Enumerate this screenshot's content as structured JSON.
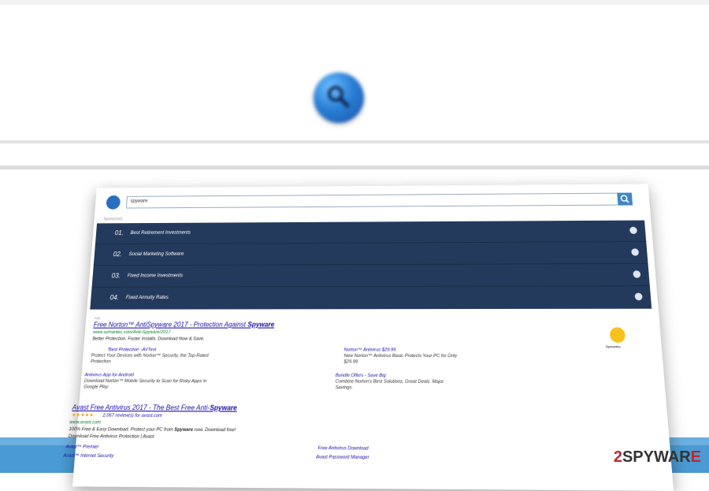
{
  "panel": {
    "search_value": "spyware",
    "sponsored_label": "Sponsored",
    "nav": [
      {
        "num": "01.",
        "label": "Best Retirement Investments"
      },
      {
        "num": "02.",
        "label": "Social Marketing Software"
      },
      {
        "num": "03.",
        "label": "Fixed Income Investments"
      },
      {
        "num": "04.",
        "label": "Fixed Annuity Rates"
      }
    ],
    "ads_label": "Ads",
    "ad1": {
      "title_prefix": "Free Norton™ AntiSpyware 2017 - Protection Against ",
      "title_bold": "Spyware",
      "url": "www.symantec.com/Anti-Spyware/2017",
      "desc": "Better Protection. Faster Installs. Download Now & Save.",
      "logo_text": "Symantec.",
      "sublinks": [
        {
          "title": "'Best Protection' -AVTest",
          "desc": "Protect Your Devices with Norton™ Security, the Top-Rated Protection"
        },
        {
          "title": "Norton™ Antivirus $29.99",
          "desc": "New Norton™ Antivirus Basic Protects Your PC for Only $29.99"
        },
        {
          "title": "Antivirus App for Android",
          "desc": "Download Norton™ Mobile Security to Scan for Risky Apps in Google Play"
        },
        {
          "title": "Bundle Offers - Save Big",
          "desc": "Combine Norton's Best Solutions. Great Deals. Major Savings."
        }
      ]
    },
    "ad2": {
      "title_prefix": "Avast Free Antivirus 2017 - The Best Free Anti-",
      "title_bold": "Spyware",
      "stars": "★★★★★",
      "reviews": "2,067 review(s) for avast.com",
      "url": "www.avast.com",
      "desc1_a": "100% Free & Easy Download. Protect your PC from ",
      "desc1_b": "Spyware",
      "desc1_c": " now. Download free!",
      "desc2": "Download Free Antivirus Protection | Avast",
      "sublinks": [
        "Avast™ Premier",
        "Free Antivirus Download",
        "Avast™ Internet Security",
        "Avast Password Manager"
      ]
    }
  },
  "watermark": {
    "two": "2",
    "mid": "SPYWAR",
    "e": "E"
  },
  "colors": {
    "nav_bg": "#243a5c",
    "accent": "#3d86c6",
    "bottom_band": "#4a9ad4"
  }
}
